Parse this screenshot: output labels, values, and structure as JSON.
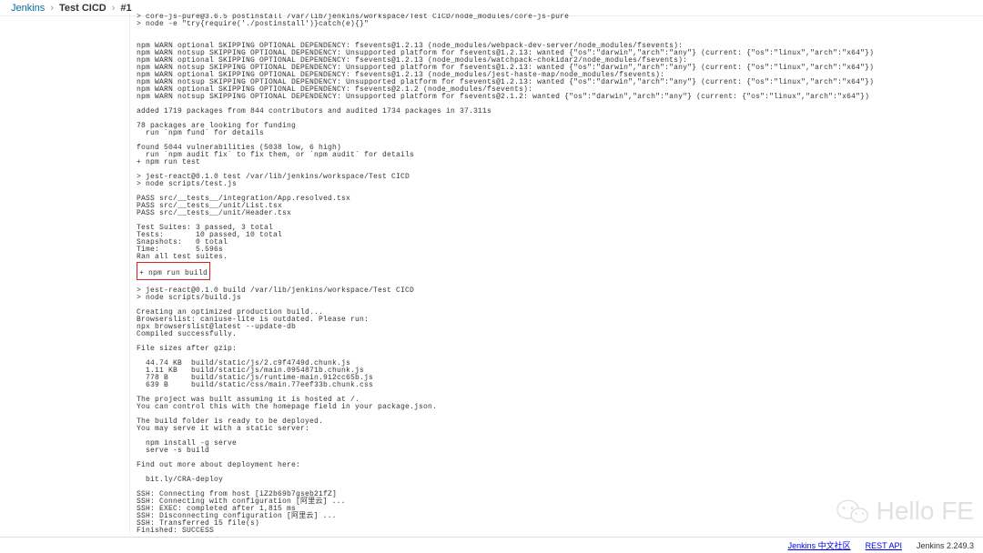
{
  "breadcrumb": {
    "root": "Jenkins",
    "project": "Test CICD",
    "build": "#1"
  },
  "footer": {
    "zh": "Jenkins 中文社区",
    "api": "REST API",
    "version": "Jenkins 2.249.3"
  },
  "watermark": {
    "text": "Hello FE"
  },
  "console": {
    "pre1": "> core-js-pure@3.6.5 postinstall /var/lib/jenkins/workspace/Test CICD/node_modules/core-js-pure\n> node -e \"try{require('./postinstall')}catch(e){}\"\n\n\nnpm WARN optional SKIPPING OPTIONAL DEPENDENCY: fsevents@1.2.13 (node_modules/webpack-dev-server/node_modules/fsevents):\nnpm WARN notsup SKIPPING OPTIONAL DEPENDENCY: Unsupported platform for fsevents@1.2.13: wanted {\"os\":\"darwin\",\"arch\":\"any\"} (current: {\"os\":\"linux\",\"arch\":\"x64\"})\nnpm WARN optional SKIPPING OPTIONAL DEPENDENCY: fsevents@1.2.13 (node_modules/watchpack-chokidar2/node_modules/fsevents):\nnpm WARN notsup SKIPPING OPTIONAL DEPENDENCY: Unsupported platform for fsevents@1.2.13: wanted {\"os\":\"darwin\",\"arch\":\"any\"} (current: {\"os\":\"linux\",\"arch\":\"x64\"})\nnpm WARN optional SKIPPING OPTIONAL DEPENDENCY: fsevents@1.2.13 (node_modules/jest-haste-map/node_modules/fsevents):\nnpm WARN notsup SKIPPING OPTIONAL DEPENDENCY: Unsupported platform for fsevents@1.2.13: wanted {\"os\":\"darwin\",\"arch\":\"any\"} (current: {\"os\":\"linux\",\"arch\":\"x64\"})\nnpm WARN optional SKIPPING OPTIONAL DEPENDENCY: fsevents@2.1.2 (node_modules/fsevents):\nnpm WARN notsup SKIPPING OPTIONAL DEPENDENCY: Unsupported platform for fsevents@2.1.2: wanted {\"os\":\"darwin\",\"arch\":\"any\"} (current: {\"os\":\"linux\",\"arch\":\"x64\"})\n\nadded 1719 packages from 844 contributors and audited 1734 packages in 37.311s\n\n78 packages are looking for funding\n  run `npm fund` for details\n\nfound 5044 vulnerabilities (5038 low, 6 high)\n  run `npm audit fix` to fix them, or `npm audit` for details\n+ npm run test\n\n> jest-react@0.1.0 test /var/lib/jenkins/workspace/Test CICD\n> node scripts/test.js\n\nPASS src/__tests__/integration/App.resolved.tsx\nPASS src/__tests__/unit/List.tsx\nPASS src/__tests__/unit/Header.tsx\n\nTest Suites: 3 passed, 3 total\nTests:       10 passed, 10 total\nSnapshots:   0 total\nTime:        5.596s\nRan all test suites.",
    "highlight": "+ npm run build",
    "pre2": "\n> jest-react@0.1.0 build /var/lib/jenkins/workspace/Test CICD\n> node scripts/build.js\n\nCreating an optimized production build...\nBrowserslist: caniuse-lite is outdated. Please run:\nnpx browserslist@latest --update-db\nCompiled successfully.\n\nFile sizes after gzip:\n\n  44.74 KB  build/static/js/2.c9f4749d.chunk.js\n  1.11 KB   build/static/js/main.0954871b.chunk.js\n  778 B     build/static/js/runtime-main.912cc65b.js\n  639 B     build/static/css/main.77eef33b.chunk.css\n\nThe project was built assuming it is hosted at /.\nYou can control this with the homepage field in your package.json.\n\nThe build folder is ready to be deployed.\nYou may serve it with a static server:\n\n  npm install -g serve\n  serve -s build\n\nFind out more about deployment here:\n\n  bit.ly/CRA-deploy\n\nSSH: Connecting from host [iZ2b69b7gseb21fZ]\nSSH: Connecting with configuration [阿里云] ...\nSSH: EXEC: completed after 1,815 ms\nSSH: Disconnecting configuration [阿里云] ...\nSSH: Transferred 15 file(s)\nFinished: SUCCESS"
  }
}
